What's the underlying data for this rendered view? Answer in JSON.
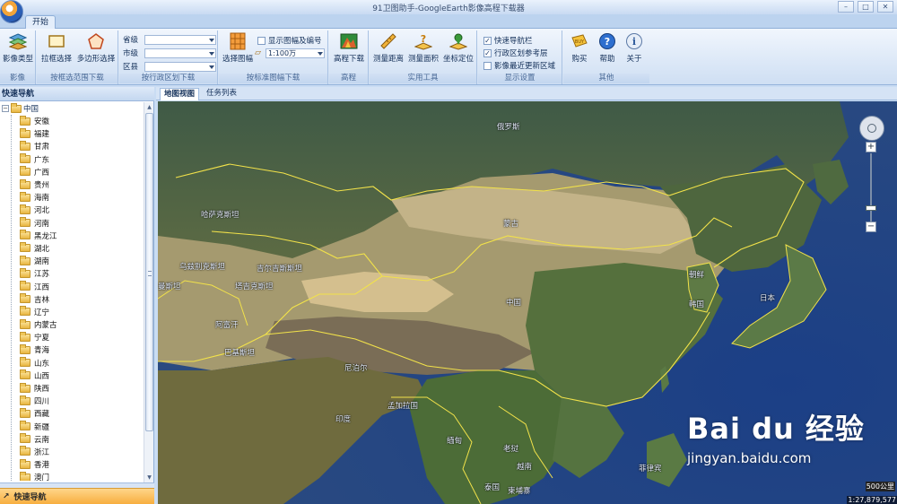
{
  "window": {
    "title": "91卫图助手-GoogleEarth影像高程下载器"
  },
  "tabs": {
    "start": "开始"
  },
  "ribbon": {
    "imagery": {
      "imagery_type": "影像类型",
      "label": "影像"
    },
    "range_select": {
      "box_select": "拉框选择",
      "polygon_select": "多边形选择",
      "label": "按框选范围下载"
    },
    "admin": {
      "province_label": "省级",
      "city_label": "市级",
      "district_label": "区县",
      "label": "按行政区划下载"
    },
    "sheet": {
      "select_sheet": "选择图幅",
      "show_sheet_number": "显示图幅及编号",
      "scale_value": "1:100万",
      "label": "按标准图幅下载"
    },
    "elevation": {
      "elevation_download": "高程下载",
      "label": "高程"
    },
    "tools": {
      "measure_distance": "测量距离",
      "measure_area": "测量面积",
      "locate_coord": "坐标定位",
      "label": "实用工具"
    },
    "display": {
      "quick_nav_bar": "快速导航栏",
      "admin_ref_layer": "行政区划参考层",
      "latest_update_area": "影像最近更新区域",
      "label": "显示设置"
    },
    "other": {
      "buy": "购买",
      "help": "帮助",
      "about": "关于",
      "label": "其他"
    }
  },
  "nav": {
    "header": "快速导航",
    "root": "中国",
    "items": [
      "安徽",
      "福建",
      "甘肃",
      "广东",
      "广西",
      "贵州",
      "海南",
      "河北",
      "河南",
      "黑龙江",
      "湖北",
      "湖南",
      "江苏",
      "江西",
      "吉林",
      "辽宁",
      "内蒙古",
      "宁夏",
      "青海",
      "山东",
      "山西",
      "陕西",
      "四川",
      "西藏",
      "新疆",
      "云南",
      "浙江",
      "香港",
      "澳门"
    ],
    "footer": "快速导航"
  },
  "map_tabs": {
    "map_view": "地图视图",
    "task_list": "任务列表"
  },
  "map": {
    "labels": {
      "russia": "俄罗斯",
      "kazakhstan": "哈萨克斯坦",
      "mongolia": "蒙古",
      "uzbekistan": "乌兹别克斯坦",
      "kyrgyzstan": "吉尔吉斯斯坦",
      "tajikistan": "塔吉克斯坦",
      "turkmenistan": "曼斯坦",
      "afghanistan": "阿富汗",
      "pakistan": "巴基斯坦",
      "china": "中国",
      "north_korea": "朝鲜",
      "south_korea": "韩国",
      "japan": "日本",
      "nepal": "尼泊尔",
      "india": "印度",
      "bangladesh": "孟加拉国",
      "myanmar": "缅甸",
      "laos": "老挝",
      "vietnam": "越南",
      "thailand": "泰国",
      "cambodia": "柬埔寨",
      "philippines": "菲律宾"
    },
    "scale_km": "500公里",
    "scale_ratio": "1:27,879,577"
  },
  "watermark": {
    "brand": "Bai du 经验",
    "url": "jingyan.baidu.com"
  }
}
